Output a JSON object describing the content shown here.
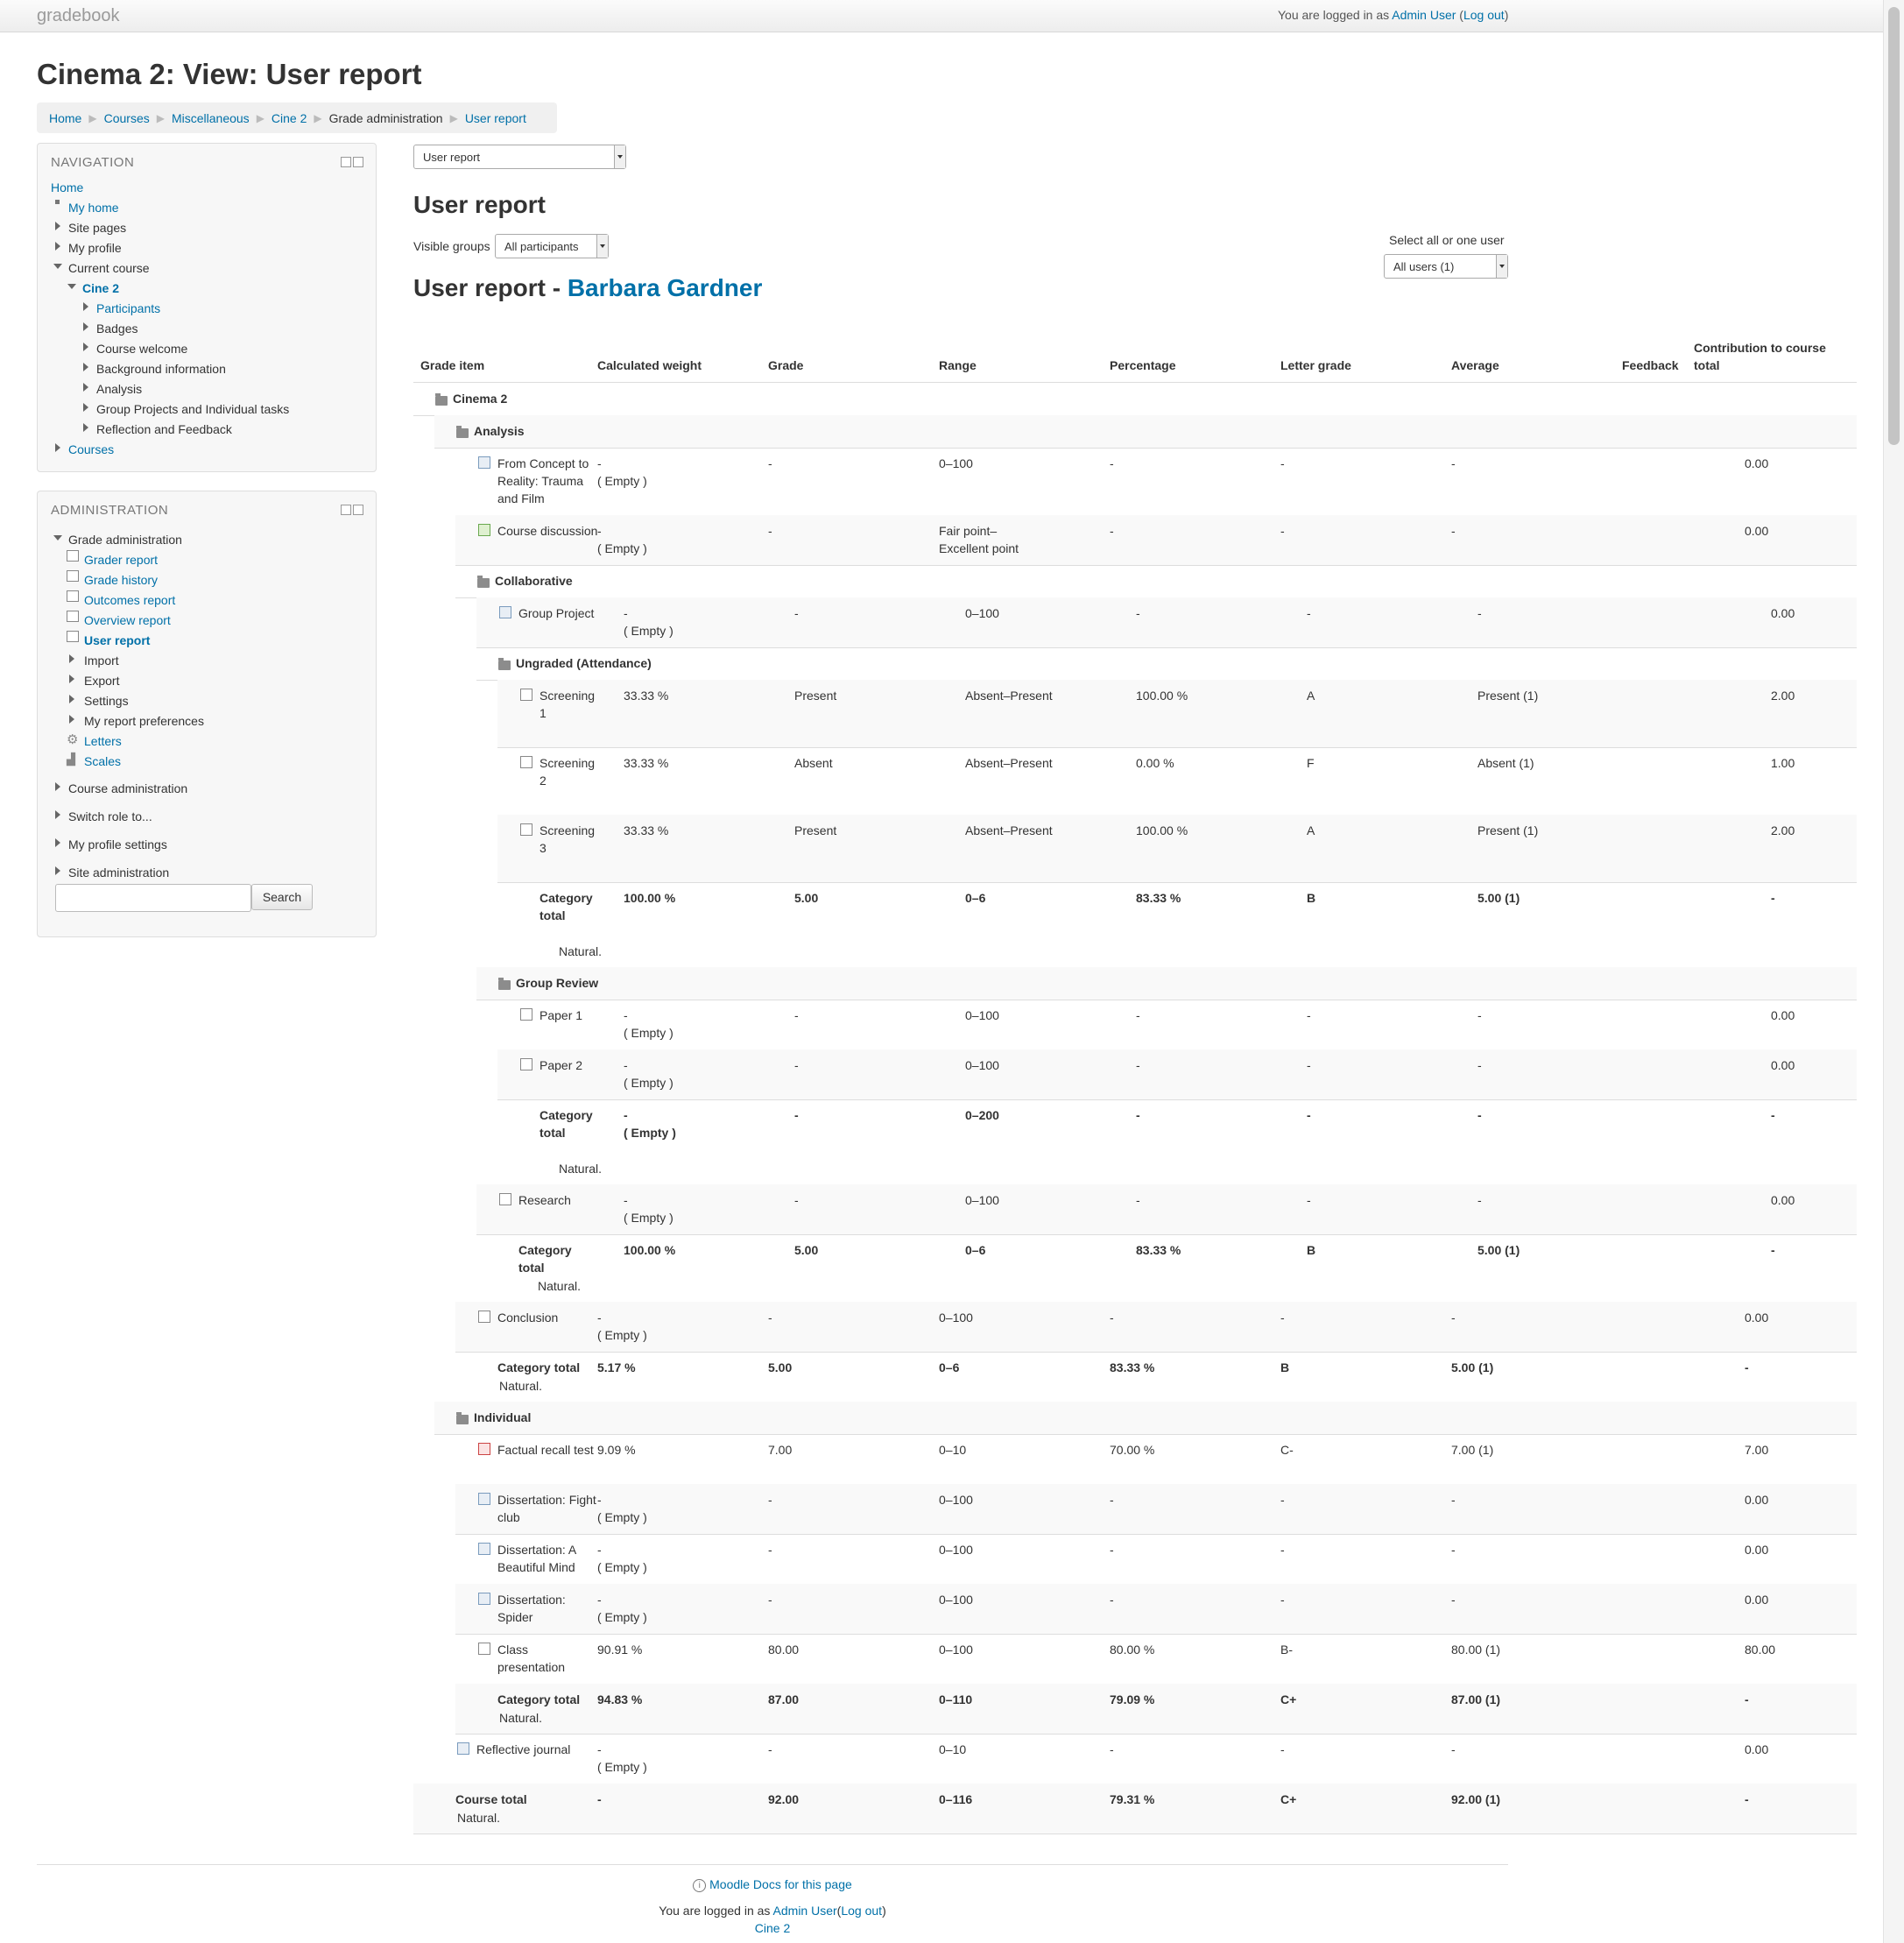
{
  "site_name": "gradebook",
  "login_top": {
    "prefix": "You are logged in as ",
    "user": "Admin User",
    "logout": "Log out"
  },
  "page_title": "Cinema 2: View: User report",
  "breadcrumb": [
    "Home",
    "Courses",
    "Miscellaneous",
    "Cine 2",
    "Grade administration",
    "User report"
  ],
  "navigation": {
    "title": "NAVIGATION",
    "items": [
      "Home",
      "My home",
      "Site pages",
      "My profile",
      "Current course",
      "Cine 2",
      "Participants",
      "Badges",
      "Course welcome",
      "Background information",
      "Analysis",
      "Group Projects and Individual tasks",
      "Reflection and Feedback",
      "Courses"
    ]
  },
  "administration": {
    "title": "ADMINISTRATION",
    "items": [
      "Grade administration",
      "Grader report",
      "Grade history",
      "Outcomes report",
      "Overview report",
      "User report",
      "Import",
      "Export",
      "Settings",
      "My report preferences",
      "Letters",
      "Scales",
      "Course administration",
      "Switch role to...",
      "My profile settings",
      "Site administration"
    ],
    "search_button": "Search"
  },
  "report_select": "User report",
  "report_heading": "User report",
  "visible_groups_label": "Visible groups",
  "visible_groups_value": "All participants",
  "select_user_label": "Select all or one user",
  "select_user_value": "All users (1)",
  "report_user_heading": "User report - ",
  "report_user_name": "Barbara Gardner",
  "columns": [
    "Grade item",
    "Calculated weight",
    "Grade",
    "Range",
    "Percentage",
    "Letter grade",
    "Average",
    "Feedback",
    "Contribution to course total"
  ],
  "rows": [
    {
      "kind": "category",
      "name": "Cinema 2"
    },
    {
      "kind": "category",
      "name": "Analysis"
    },
    {
      "kind": "item",
      "name": "From Concept to Reality: Trauma and Film",
      "weight": "-",
      "weight2": "( Empty )",
      "grade": "-",
      "range": "0–100",
      "pct": "-",
      "letter": "-",
      "avg": "-",
      "contrib": "0.00"
    },
    {
      "kind": "item",
      "name": "Course discussion",
      "weight": "-",
      "weight2": "( Empty )",
      "grade": "-",
      "range": "Fair point–Excellent point",
      "pct": "-",
      "letter": "-",
      "avg": "-",
      "contrib": "0.00"
    },
    {
      "kind": "category",
      "name": "Collaborative"
    },
    {
      "kind": "item",
      "name": "Group Project",
      "weight": "-",
      "weight2": "( Empty )",
      "grade": "-",
      "range": "0–100",
      "pct": "-",
      "letter": "-",
      "avg": "-",
      "contrib": "0.00"
    },
    {
      "kind": "category",
      "name": "Ungraded (Attendance)"
    },
    {
      "kind": "item",
      "name": "Screening 1",
      "weight": "33.33 %",
      "grade": "Present",
      "range": "Absent–Present",
      "pct": "100.00 %",
      "letter": "A",
      "avg": "Present (1)",
      "contrib": "2.00"
    },
    {
      "kind": "item",
      "name": "Screening 2",
      "weight": "33.33 %",
      "grade": "Absent",
      "range": "Absent–Present",
      "pct": "0.00 %",
      "letter": "F",
      "avg": "Absent (1)",
      "contrib": "1.00"
    },
    {
      "kind": "item",
      "name": "Screening 3",
      "weight": "33.33 %",
      "grade": "Present",
      "range": "Absent–Present",
      "pct": "100.00 %",
      "letter": "A",
      "avg": "Present (1)",
      "contrib": "2.00"
    },
    {
      "kind": "total",
      "name": "Category total",
      "sub": "Natural.",
      "weight": "100.00 %",
      "grade": "5.00",
      "range": "0–6",
      "pct": "83.33 %",
      "letter": "B",
      "avg": "5.00 (1)",
      "contrib": "-"
    },
    {
      "kind": "category",
      "name": "Group Review"
    },
    {
      "kind": "item",
      "name": "Paper 1",
      "weight": "-",
      "weight2": "( Empty )",
      "grade": "-",
      "range": "0–100",
      "pct": "-",
      "letter": "-",
      "avg": "-",
      "contrib": "0.00"
    },
    {
      "kind": "item",
      "name": "Paper 2",
      "weight": "-",
      "weight2": "( Empty )",
      "grade": "-",
      "range": "0–100",
      "pct": "-",
      "letter": "-",
      "avg": "-",
      "contrib": "0.00"
    },
    {
      "kind": "total",
      "name": "Category total",
      "sub": "Natural.",
      "weight": "-",
      "weight2": "( Empty )",
      "grade": "-",
      "range": "0–200",
      "pct": "-",
      "letter": "-",
      "avg": "-",
      "contrib": "-"
    },
    {
      "kind": "item",
      "name": "Research",
      "weight": "-",
      "weight2": "( Empty )",
      "grade": "-",
      "range": "0–100",
      "pct": "-",
      "letter": "-",
      "avg": "-",
      "contrib": "0.00"
    },
    {
      "kind": "total",
      "name": "Category total",
      "sub": "Natural.",
      "weight": "100.00 %",
      "grade": "5.00",
      "range": "0–6",
      "pct": "83.33 %",
      "letter": "B",
      "avg": "5.00 (1)",
      "contrib": "-"
    },
    {
      "kind": "item",
      "name": "Conclusion",
      "weight": "-",
      "weight2": "( Empty )",
      "grade": "-",
      "range": "0–100",
      "pct": "-",
      "letter": "-",
      "avg": "-",
      "contrib": "0.00"
    },
    {
      "kind": "total",
      "name": "Category total",
      "sub": "Natural.",
      "weight": "5.17 %",
      "grade": "5.00",
      "range": "0–6",
      "pct": "83.33 %",
      "letter": "B",
      "avg": "5.00 (1)",
      "contrib": "-"
    },
    {
      "kind": "category",
      "name": "Individual"
    },
    {
      "kind": "item",
      "name": "Factual recall test",
      "weight": "9.09 %",
      "grade": "7.00",
      "range": "0–10",
      "pct": "70.00 %",
      "letter": "C-",
      "avg": "7.00 (1)",
      "contrib": "7.00"
    },
    {
      "kind": "item",
      "name": "Dissertation: Fight club",
      "weight": "-",
      "weight2": "( Empty )",
      "grade": "-",
      "range": "0–100",
      "pct": "-",
      "letter": "-",
      "avg": "-",
      "contrib": "0.00"
    },
    {
      "kind": "item",
      "name": "Dissertation: A Beautiful Mind",
      "weight": "-",
      "weight2": "( Empty )",
      "grade": "-",
      "range": "0–100",
      "pct": "-",
      "letter": "-",
      "avg": "-",
      "contrib": "0.00"
    },
    {
      "kind": "item",
      "name": "Dissertation: Spider",
      "weight": "-",
      "weight2": "( Empty )",
      "grade": "-",
      "range": "0–100",
      "pct": "-",
      "letter": "-",
      "avg": "-",
      "contrib": "0.00"
    },
    {
      "kind": "item",
      "name": "Class presentation",
      "weight": "90.91 %",
      "grade": "80.00",
      "range": "0–100",
      "pct": "80.00 %",
      "letter": "B-",
      "avg": "80.00 (1)",
      "contrib": "80.00"
    },
    {
      "kind": "total",
      "name": "Category total",
      "sub": "Natural.",
      "weight": "94.83 %",
      "grade": "87.00",
      "range": "0–110",
      "pct": "79.09 %",
      "letter": "C+",
      "avg": "87.00 (1)",
      "contrib": "-"
    },
    {
      "kind": "item",
      "name": "Reflective journal",
      "weight": "-",
      "weight2": "( Empty )",
      "grade": "-",
      "range": "0–10",
      "pct": "-",
      "letter": "-",
      "avg": "-",
      "contrib": "0.00"
    },
    {
      "kind": "total",
      "name": "Course total",
      "sub": "Natural.",
      "weight": "-",
      "grade": "92.00",
      "range": "0–116",
      "pct": "79.31 %",
      "letter": "C+",
      "avg": "92.00 (1)",
      "contrib": "-"
    }
  ],
  "footer": {
    "docs": "Moodle Docs for this page",
    "login_prefix": "You are logged in as ",
    "user": "Admin User",
    "logout": "Log out",
    "course": "Cine 2"
  }
}
